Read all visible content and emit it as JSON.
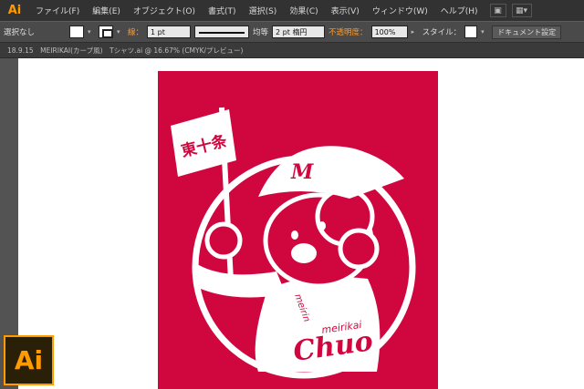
{
  "menu": {
    "logo": "Ai",
    "items": [
      "ファイル(F)",
      "編集(E)",
      "オブジェクト(O)",
      "書式(T)",
      "選択(S)",
      "効果(C)",
      "表示(V)",
      "ウィンドウ(W)",
      "ヘルプ(H)"
    ]
  },
  "control": {
    "selection": "選択なし",
    "stroke_label": "線：",
    "stroke_weight": "1 pt",
    "stroke_profile": "均等",
    "brush": "2 pt 楕円",
    "opacity_label": "不透明度：",
    "opacity_value": "100%",
    "style_label": "スタイル：",
    "doc_settings": "ドキュメント設定"
  },
  "tabs": {
    "left_info": "18.9.15　MEIRIKAI(カープ風)　Tシャツ.ai @ 16.67% (CMYK/プレビュー)"
  },
  "artwork": {
    "flag_text": "東十条",
    "cap_letter": "M",
    "sleeve_text": "meirin",
    "chest_small": "meirikai",
    "chest_big": "Chuo",
    "bg_color": "#d0073f"
  },
  "badge": "Ai"
}
